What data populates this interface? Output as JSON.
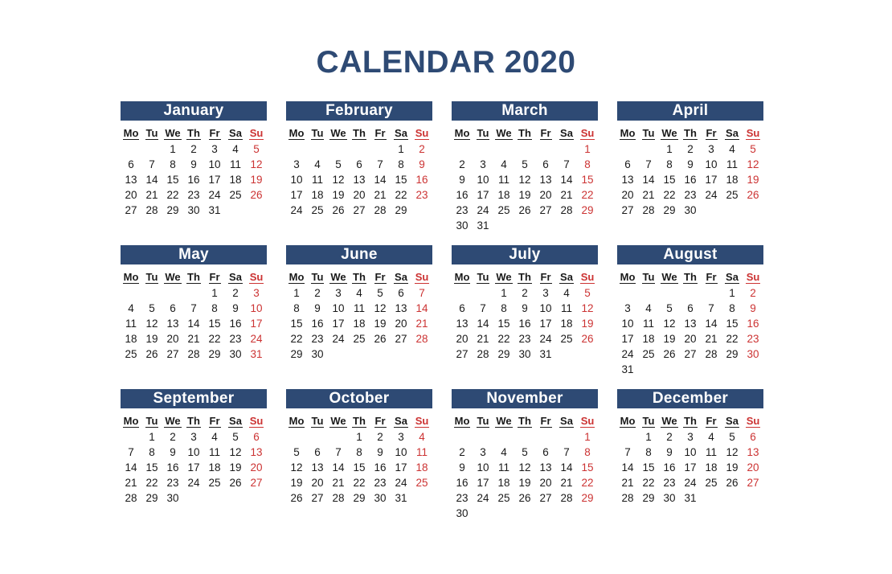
{
  "title": "CALENDAR 2020",
  "year": "2020",
  "colors": {
    "header_bar": "#2e4a74",
    "title": "#2e4a74",
    "sunday": "#cc3333",
    "weekday": "#1a1a1a",
    "background": "#ffffff"
  },
  "weekday_headers": [
    "Mo",
    "Tu",
    "We",
    "Th",
    "Fr",
    "Sa",
    "Su"
  ],
  "months": [
    {
      "name": "January",
      "weeks": [
        [
          "",
          "",
          "1",
          "2",
          "3",
          "4",
          "5"
        ],
        [
          "6",
          "7",
          "8",
          "9",
          "10",
          "11",
          "12"
        ],
        [
          "13",
          "14",
          "15",
          "16",
          "17",
          "18",
          "19"
        ],
        [
          "20",
          "21",
          "22",
          "23",
          "24",
          "25",
          "26"
        ],
        [
          "27",
          "28",
          "29",
          "30",
          "31",
          "",
          ""
        ],
        [
          "",
          "",
          "",
          "",
          "",
          "",
          ""
        ]
      ]
    },
    {
      "name": "February",
      "weeks": [
        [
          "",
          "",
          "",
          "",
          "",
          "1",
          "2"
        ],
        [
          "3",
          "4",
          "5",
          "6",
          "7",
          "8",
          "9"
        ],
        [
          "10",
          "11",
          "12",
          "13",
          "14",
          "15",
          "16"
        ],
        [
          "17",
          "18",
          "19",
          "20",
          "21",
          "22",
          "23"
        ],
        [
          "24",
          "25",
          "26",
          "27",
          "28",
          "29",
          ""
        ],
        [
          "",
          "",
          "",
          "",
          "",
          "",
          ""
        ]
      ]
    },
    {
      "name": "March",
      "weeks": [
        [
          "",
          "",
          "",
          "",
          "",
          "",
          "1"
        ],
        [
          "2",
          "3",
          "4",
          "5",
          "6",
          "7",
          "8"
        ],
        [
          "9",
          "10",
          "11",
          "12",
          "13",
          "14",
          "15"
        ],
        [
          "16",
          "17",
          "18",
          "19",
          "20",
          "21",
          "22"
        ],
        [
          "23",
          "24",
          "25",
          "26",
          "27",
          "28",
          "29"
        ],
        [
          "30",
          "31",
          "",
          "",
          "",
          "",
          ""
        ]
      ]
    },
    {
      "name": "April",
      "weeks": [
        [
          "",
          "",
          "1",
          "2",
          "3",
          "4",
          "5"
        ],
        [
          "6",
          "7",
          "8",
          "9",
          "10",
          "11",
          "12"
        ],
        [
          "13",
          "14",
          "15",
          "16",
          "17",
          "18",
          "19"
        ],
        [
          "20",
          "21",
          "22",
          "23",
          "24",
          "25",
          "26"
        ],
        [
          "27",
          "28",
          "29",
          "30",
          "",
          "",
          ""
        ],
        [
          "",
          "",
          "",
          "",
          "",
          "",
          ""
        ]
      ]
    },
    {
      "name": "May",
      "weeks": [
        [
          "",
          "",
          "",
          "",
          "1",
          "2",
          "3"
        ],
        [
          "4",
          "5",
          "6",
          "7",
          "8",
          "9",
          "10"
        ],
        [
          "11",
          "12",
          "13",
          "14",
          "15",
          "16",
          "17"
        ],
        [
          "18",
          "19",
          "20",
          "21",
          "22",
          "23",
          "24"
        ],
        [
          "25",
          "26",
          "27",
          "28",
          "29",
          "30",
          "31"
        ],
        [
          "",
          "",
          "",
          "",
          "",
          "",
          ""
        ]
      ]
    },
    {
      "name": "June",
      "weeks": [
        [
          "1",
          "2",
          "3",
          "4",
          "5",
          "6",
          "7"
        ],
        [
          "8",
          "9",
          "10",
          "11",
          "12",
          "13",
          "14"
        ],
        [
          "15",
          "16",
          "17",
          "18",
          "19",
          "20",
          "21"
        ],
        [
          "22",
          "23",
          "24",
          "25",
          "26",
          "27",
          "28"
        ],
        [
          "29",
          "30",
          "",
          "",
          "",
          "",
          ""
        ],
        [
          "",
          "",
          "",
          "",
          "",
          "",
          ""
        ]
      ]
    },
    {
      "name": "July",
      "weeks": [
        [
          "",
          "",
          "1",
          "2",
          "3",
          "4",
          "5"
        ],
        [
          "6",
          "7",
          "8",
          "9",
          "10",
          "11",
          "12"
        ],
        [
          "13",
          "14",
          "15",
          "16",
          "17",
          "18",
          "19"
        ],
        [
          "20",
          "21",
          "22",
          "23",
          "24",
          "25",
          "26"
        ],
        [
          "27",
          "28",
          "29",
          "30",
          "31",
          "",
          ""
        ],
        [
          "",
          "",
          "",
          "",
          "",
          "",
          ""
        ]
      ]
    },
    {
      "name": "August",
      "weeks": [
        [
          "",
          "",
          "",
          "",
          "",
          "1",
          "2"
        ],
        [
          "3",
          "4",
          "5",
          "6",
          "7",
          "8",
          "9"
        ],
        [
          "10",
          "11",
          "12",
          "13",
          "14",
          "15",
          "16"
        ],
        [
          "17",
          "18",
          "19",
          "20",
          "21",
          "22",
          "23"
        ],
        [
          "24",
          "25",
          "26",
          "27",
          "28",
          "29",
          "30"
        ],
        [
          "31",
          "",
          "",
          "",
          "",
          "",
          ""
        ]
      ]
    },
    {
      "name": "September",
      "weeks": [
        [
          "",
          "1",
          "2",
          "3",
          "4",
          "5",
          "6"
        ],
        [
          "7",
          "8",
          "9",
          "10",
          "11",
          "12",
          "13"
        ],
        [
          "14",
          "15",
          "16",
          "17",
          "18",
          "19",
          "20"
        ],
        [
          "21",
          "22",
          "23",
          "24",
          "25",
          "26",
          "27"
        ],
        [
          "28",
          "29",
          "30",
          "",
          "",
          "",
          ""
        ],
        [
          "",
          "",
          "",
          "",
          "",
          "",
          ""
        ]
      ]
    },
    {
      "name": "October",
      "weeks": [
        [
          "",
          "",
          "",
          "1",
          "2",
          "3",
          "4"
        ],
        [
          "5",
          "6",
          "7",
          "8",
          "9",
          "10",
          "11"
        ],
        [
          "12",
          "13",
          "14",
          "15",
          "16",
          "17",
          "18"
        ],
        [
          "19",
          "20",
          "21",
          "22",
          "23",
          "24",
          "25"
        ],
        [
          "26",
          "27",
          "28",
          "29",
          "30",
          "31",
          ""
        ],
        [
          "",
          "",
          "",
          "",
          "",
          "",
          ""
        ]
      ]
    },
    {
      "name": "November",
      "weeks": [
        [
          "",
          "",
          "",
          "",
          "",
          "",
          "1"
        ],
        [
          "2",
          "3",
          "4",
          "5",
          "6",
          "7",
          "8"
        ],
        [
          "9",
          "10",
          "11",
          "12",
          "13",
          "14",
          "15"
        ],
        [
          "16",
          "17",
          "18",
          "19",
          "20",
          "21",
          "22"
        ],
        [
          "23",
          "24",
          "25",
          "26",
          "27",
          "28",
          "29"
        ],
        [
          "30",
          "",
          "",
          "",
          "",
          "",
          ""
        ]
      ]
    },
    {
      "name": "December",
      "weeks": [
        [
          "",
          "1",
          "2",
          "3",
          "4",
          "5",
          "6"
        ],
        [
          "7",
          "8",
          "9",
          "10",
          "11",
          "12",
          "13"
        ],
        [
          "14",
          "15",
          "16",
          "17",
          "18",
          "19",
          "20"
        ],
        [
          "21",
          "22",
          "23",
          "24",
          "25",
          "26",
          "27"
        ],
        [
          "28",
          "29",
          "30",
          "31",
          "",
          "",
          ""
        ],
        [
          "",
          "",
          "",
          "",
          "",
          "",
          ""
        ]
      ]
    }
  ]
}
